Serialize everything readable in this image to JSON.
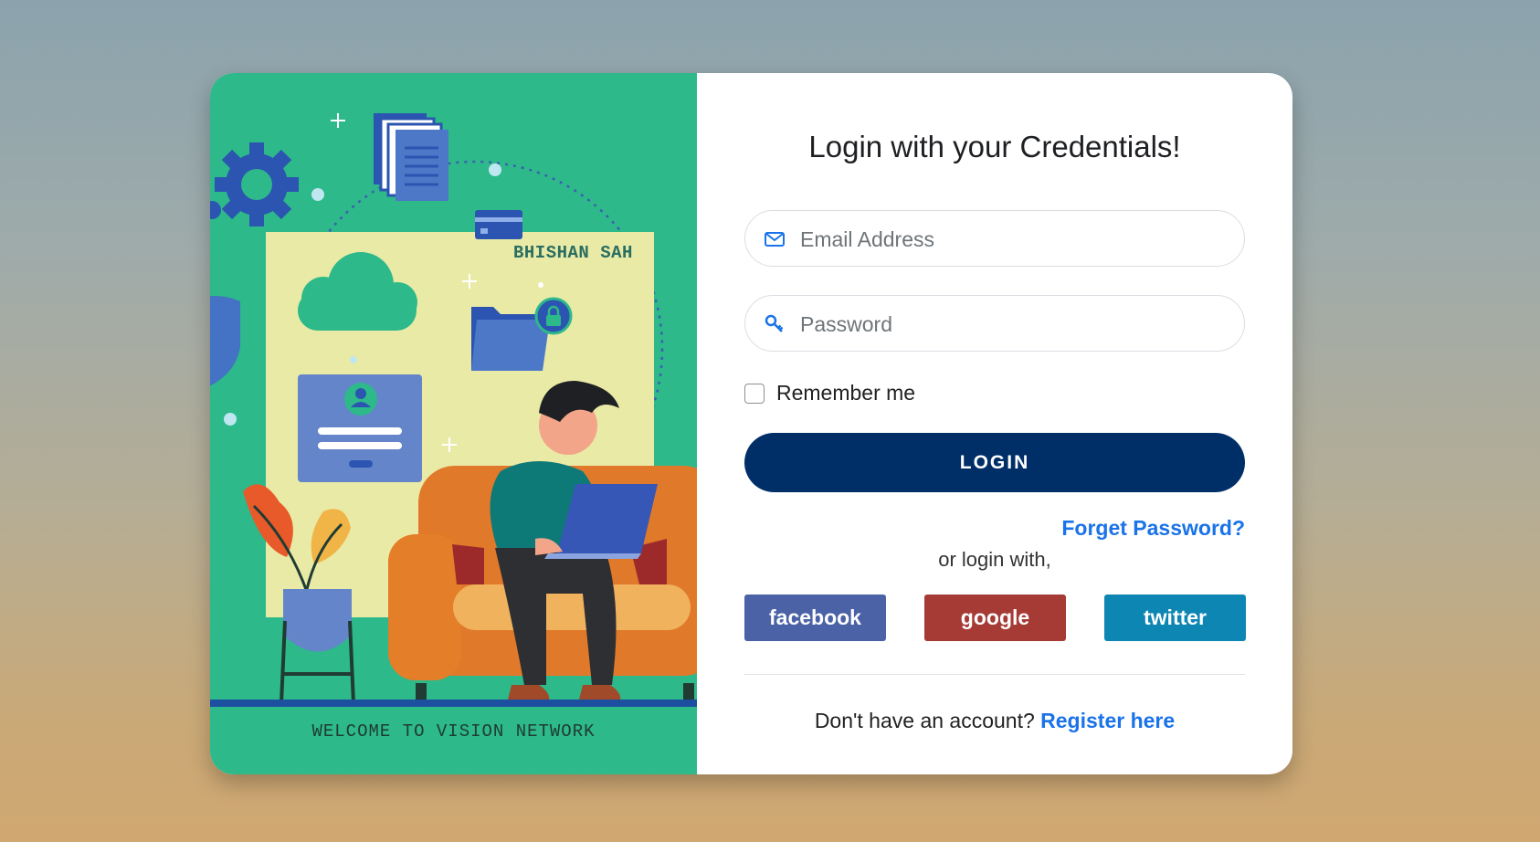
{
  "illustration": {
    "brand_text": "BHISHAN SAH",
    "welcome_text": "WELCOME TO VISION NETWORK"
  },
  "login_form": {
    "title": "Login with your Credentials!",
    "email": {
      "placeholder": "Email Address",
      "value": "",
      "icon": "envelope-icon"
    },
    "password": {
      "placeholder": "Password",
      "value": "",
      "icon": "key-icon"
    },
    "remember_label": "Remember me",
    "remember_checked": false,
    "login_label": "LOGIN",
    "forgot_label": "Forget Password?",
    "or_label": "or login with,",
    "social": {
      "facebook": "facebook",
      "google": "google",
      "twitter": "twitter"
    },
    "register_prompt": "Don't have an account?",
    "register_link": "Register here"
  },
  "colors": {
    "primary": "#002f68",
    "link": "#1a73e8",
    "illustration_bg": "#2db98a",
    "facebook": "#4b62a6",
    "google": "#a63b36",
    "twitter": "#0d86b4"
  }
}
